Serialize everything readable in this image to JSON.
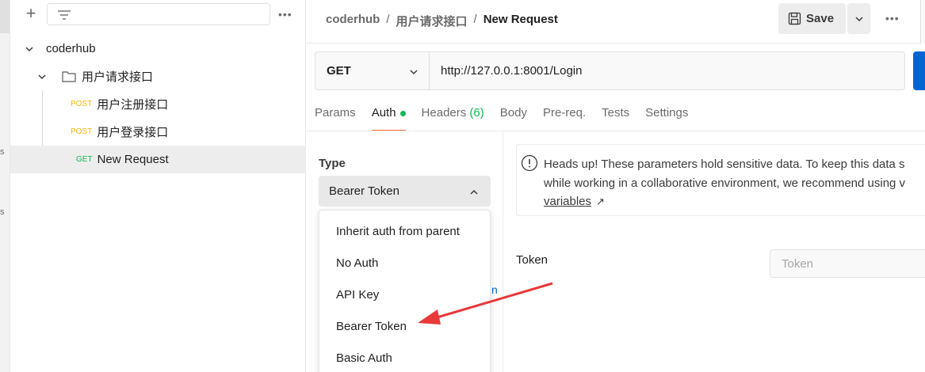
{
  "sidebar": {
    "collection_name": "coderhub",
    "folder_name": "用户请求接口",
    "items": [
      {
        "method": "POST",
        "label": "用户注册接口"
      },
      {
        "method": "POST",
        "label": "用户登录接口"
      },
      {
        "method": "GET",
        "label": "New Request"
      }
    ]
  },
  "header": {
    "breadcrumb": [
      "coderhub",
      "用户请求接口",
      "New Request"
    ],
    "save_label": "Save"
  },
  "request": {
    "method": "GET",
    "url": "http://127.0.0.1:8001/Login"
  },
  "tabs": [
    {
      "label": "Params"
    },
    {
      "label": "Auth"
    },
    {
      "label": "Headers",
      "count": "(6)"
    },
    {
      "label": "Body"
    },
    {
      "label": "Pre-req."
    },
    {
      "label": "Tests"
    },
    {
      "label": "Settings"
    }
  ],
  "auth": {
    "type_label": "Type",
    "selected_type": "Bearer Token",
    "options": [
      "Inherit auth from parent",
      "No Auth",
      "API Key",
      "Bearer Token",
      "Basic Auth"
    ],
    "notice_line1": "Heads up! These parameters hold sensitive data. To keep this data s",
    "notice_line2": "while working in a collaborative environment, we recommend using v",
    "notice_link": "variables",
    "token_label": "Token",
    "token_placeholder": "Token",
    "partial_link": "n"
  },
  "colors": {
    "accent": "#ff6c37",
    "post": "#ffb400",
    "get": "#0cbb52",
    "annotation_arrow": "#e8393b"
  }
}
